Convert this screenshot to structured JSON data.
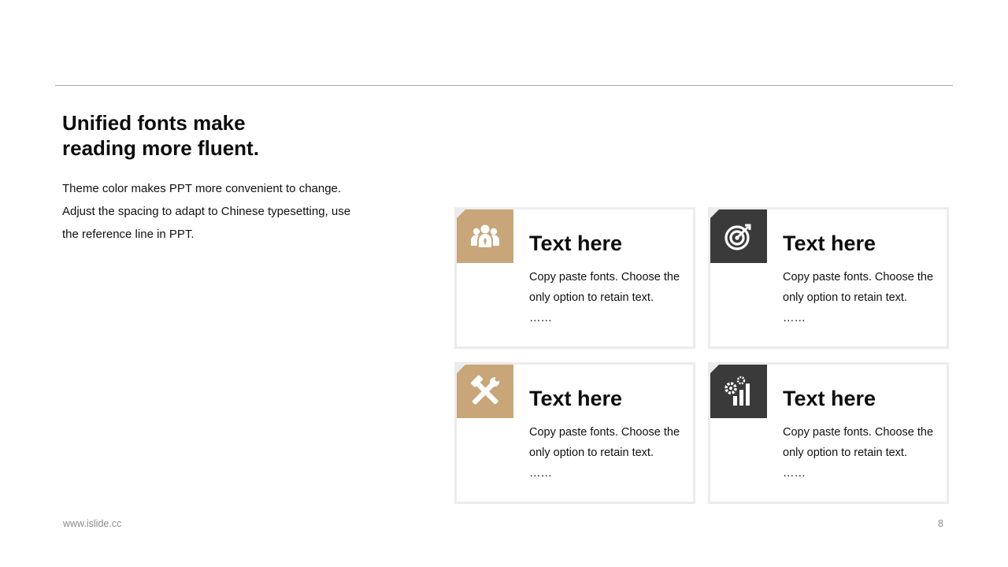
{
  "colors": {
    "accent_tan": "#c8a679",
    "accent_dark": "#3a3a3a"
  },
  "header": {
    "title_line1": "Unified fonts make",
    "title_line2": "reading more fluent."
  },
  "intro": {
    "line1": "Theme color makes PPT more convenient to change.",
    "line2": "Adjust the spacing to adapt to Chinese typesetting, use",
    "line3": "the reference line in PPT."
  },
  "cards": [
    {
      "icon": "team-icon",
      "title": "Text here",
      "line1": "Copy paste fonts. Choose the",
      "line2": "only option to retain text.",
      "line3": "……"
    },
    {
      "icon": "target-icon",
      "title": "Text here",
      "line1": "Copy paste fonts. Choose the",
      "line2": "only option to retain text.",
      "line3": "……"
    },
    {
      "icon": "tools-icon",
      "title": "Text here",
      "line1": "Copy paste fonts. Choose the",
      "line2": "only option to retain text.",
      "line3": "……"
    },
    {
      "icon": "growth-chart-icon",
      "title": "Text here",
      "line1": "Copy paste fonts. Choose the",
      "line2": "only option to retain text.",
      "line3": "……"
    }
  ],
  "footer": {
    "url": "www.islide.cc",
    "page_number": "8"
  }
}
